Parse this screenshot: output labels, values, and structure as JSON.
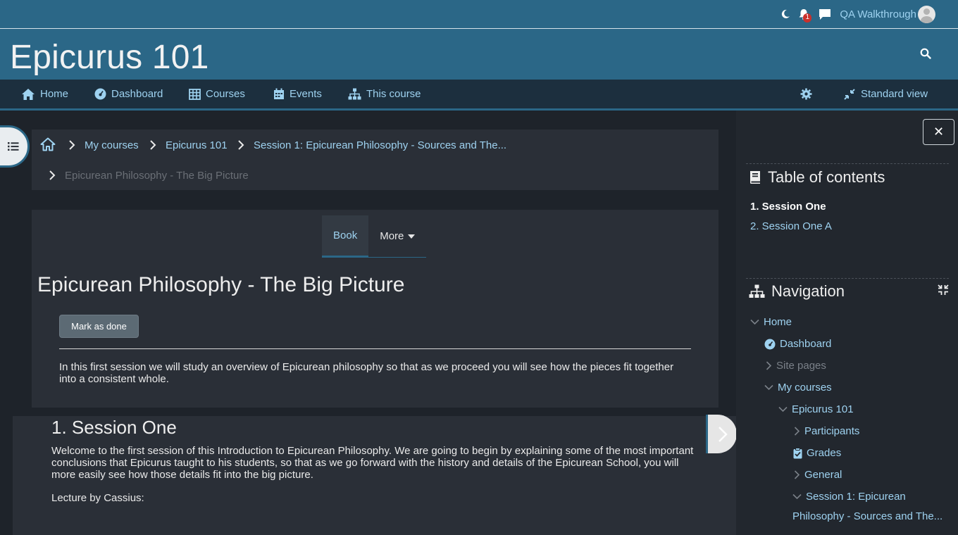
{
  "topbar": {
    "user_name": "QA Walkthrough",
    "notification_count": "1"
  },
  "header": {
    "site_title": "Epicurus 101"
  },
  "nav": {
    "items": [
      {
        "label": "Home",
        "icon": "home-icon"
      },
      {
        "label": "Dashboard",
        "icon": "dashboard-icon"
      },
      {
        "label": "Courses",
        "icon": "table-icon"
      },
      {
        "label": "Events",
        "icon": "calendar-icon"
      },
      {
        "label": "This course",
        "icon": "sitemap-icon"
      }
    ],
    "settings_icon": "gear-icon",
    "standard_view_label": "Standard view"
  },
  "breadcrumb": {
    "items": [
      "My courses",
      "Epicurus 101",
      "Session 1: Epicurean Philosophy - Sources and The..."
    ],
    "current": "Epicurean Philosophy - The Big Picture"
  },
  "main": {
    "tabs": [
      {
        "label": "Book",
        "active": true
      },
      {
        "label": "More",
        "active": false
      }
    ],
    "page_title": "Epicurean Philosophy - The Big Picture",
    "mark_done_label": "Mark as done",
    "intro_text": "In this first session we will study an overview of Epicurean philosophy so that as we proceed you will see how the pieces fit together into a consistent whole.",
    "section_title": "1. Session One",
    "section_text": "Welcome to the first session of this Introduction to Epicurean Philosophy.  We are going to begin by explaining some of the most important conclusions that Epicurus taught to his students, so that as we go forward with the history and details of the Epicurean School, you will more easily see how those details fit into the big picture.",
    "lecture_label": "Lecture by Cassius:"
  },
  "drawer": {
    "close_label": "✕",
    "toc_title": "Table of contents",
    "toc_items": [
      "1. Session One",
      "2. Session One A"
    ],
    "navigation_title": "Navigation",
    "nav_tree": {
      "home": "Home",
      "dashboard": "Dashboard",
      "site_pages": "Site pages",
      "my_courses": "My courses",
      "course": "Epicurus 101",
      "participants": "Participants",
      "grades": "Grades",
      "general": "General",
      "session_line1": "Session 1: Epicurean",
      "session_line2": "Philosophy - Sources and The..."
    }
  },
  "colors": {
    "header_bg": "#2b6787",
    "link": "#9ed2f0",
    "page_bg": "#1e232a",
    "panel_bg": "#2a2f37"
  }
}
